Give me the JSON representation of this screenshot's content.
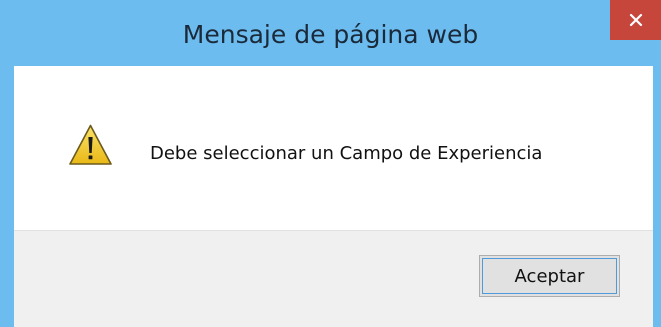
{
  "dialog": {
    "title": "Mensaje de página web",
    "message": "Debe seleccionar un Campo de Experiencia",
    "accept_label": "Aceptar",
    "close_icon": "close-icon",
    "warning_icon": "warning-icon"
  },
  "colors": {
    "titlebar": "#6cbcef",
    "close_button": "#c7463c",
    "content_bg": "#ffffff",
    "footer_bg": "#f0f0f0",
    "button_bg": "#e1e1e1",
    "warning_yellow": "#f4d02c"
  }
}
